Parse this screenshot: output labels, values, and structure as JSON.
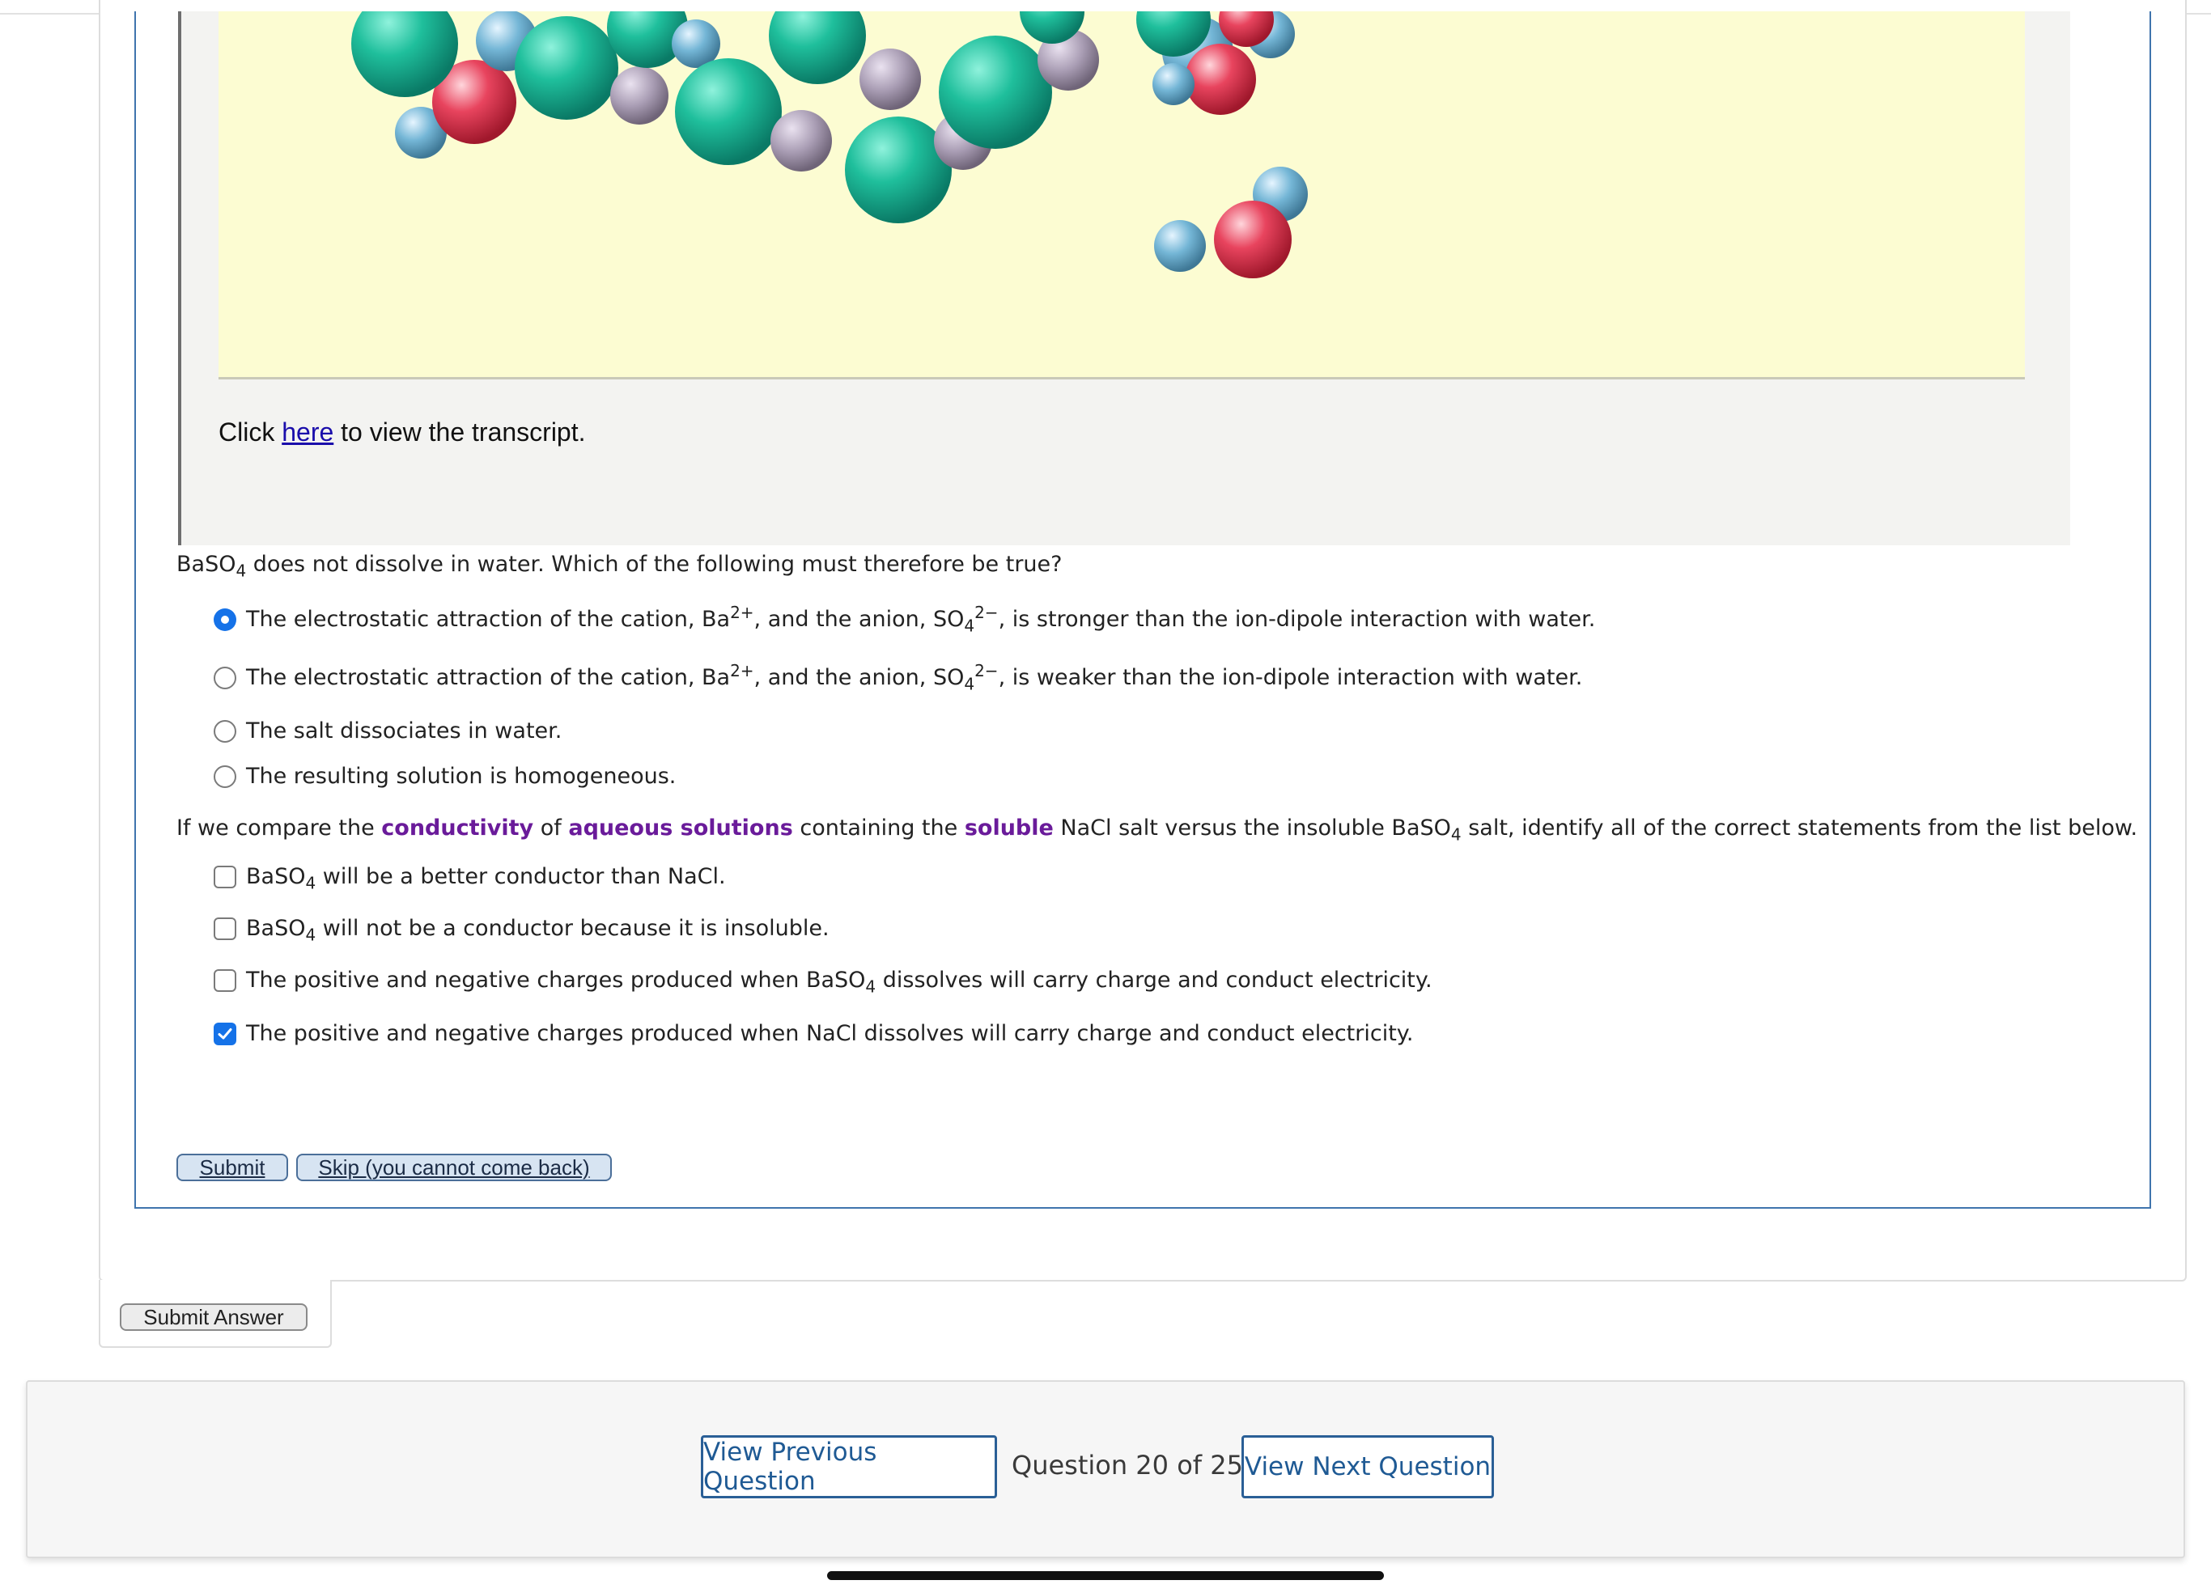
{
  "transcript": {
    "prefix": "Click ",
    "link": "here",
    "suffix": " to view the transcript."
  },
  "question1": {
    "stem_a": "BaSO",
    "stem_sub": "4",
    "stem_b": " does not dissolve in water. Which of the following must therefore be true?",
    "selected_index": 0,
    "options": [
      {
        "a": "The electrostatic attraction of the cation, Ba",
        "sup1": "2+",
        "b": ", and the anion, SO",
        "sub": "4",
        "sup2": "2−",
        "c": ", is stronger than the ion-dipole interaction with water."
      },
      {
        "a": "The electrostatic attraction of the cation, Ba",
        "sup1": "2+",
        "b": ", and the anion, SO",
        "sub": "4",
        "sup2": "2−",
        "c": ", is weaker than the ion-dipole interaction with water."
      },
      {
        "text": "The salt dissociates in water."
      },
      {
        "text": "The resulting solution is homogeneous."
      }
    ]
  },
  "question2": {
    "stem_1": "If we compare the ",
    "term_1": "conductivity",
    "stem_2": " of ",
    "term_2": "aqueous solutions",
    "stem_3": " containing the ",
    "term_3": "soluble",
    "stem_4": " NaCl salt versus the insoluble BaSO",
    "stem_sub": "4",
    "stem_5": " salt, identify all of the correct statements from the list below.",
    "options": [
      {
        "a": "BaSO",
        "sub": "4",
        "b": " will be a better conductor than NaCl.",
        "checked": false
      },
      {
        "a": "BaSO",
        "sub": "4",
        "b": " will not be a conductor because it is insoluble.",
        "checked": false
      },
      {
        "a": "The positive and negative charges produced when BaSO",
        "sub": "4",
        "b": " dissolves will carry charge and conduct electricity.",
        "checked": false
      },
      {
        "a": "The positive and negative charges produced when NaCl dissolves will carry charge and conduct electricity.",
        "checked": true
      }
    ]
  },
  "buttons": {
    "submit": "Submit",
    "skip": "Skip (you cannot come back)",
    "submit_answer": "Submit Answer"
  },
  "nav": {
    "prev": "View Previous Question",
    "counter": "Question 20 of 25",
    "next": "View Next Question"
  },
  "colors": {
    "accent": "#1572e8",
    "keyword": "#6a1b9a",
    "frame": "#3f74ad",
    "stage": "#fcfcd2"
  }
}
